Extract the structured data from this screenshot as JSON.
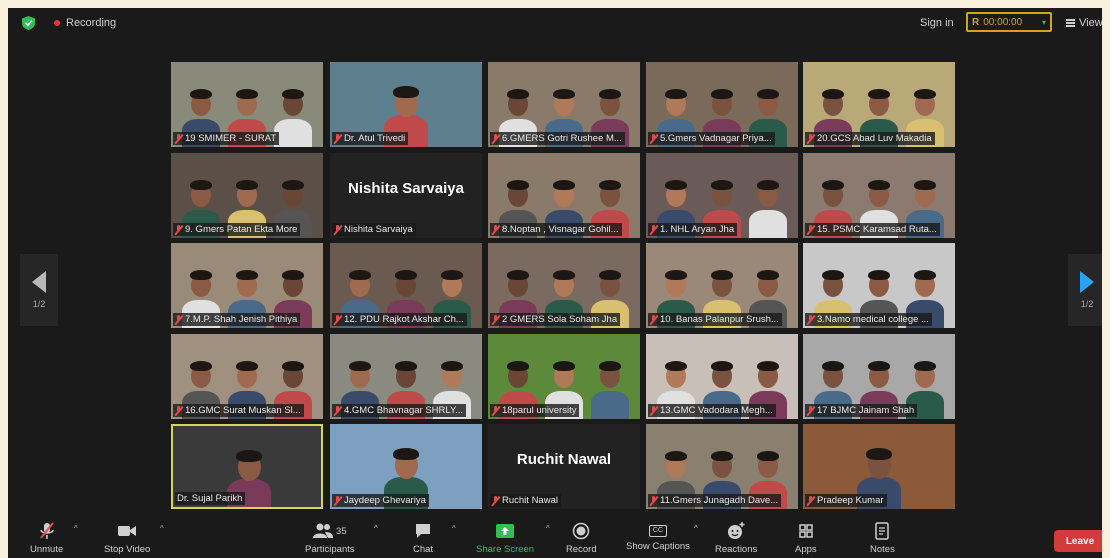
{
  "top": {
    "recording_label": "Recording",
    "sign_in": "Sign in",
    "timer": "00:00:00",
    "view_label": "View"
  },
  "pager": {
    "left": "1/2",
    "right": "1/2"
  },
  "tiles": [
    {
      "name": "19 SMIMER - SURAT",
      "people": 3,
      "bg": "#8a8a7a"
    },
    {
      "name": "Dr. Atul Trivedi",
      "people": 1,
      "bg": "#5d7f8e"
    },
    {
      "name": "6.GMERS Gotri Rushee M...",
      "people": 3,
      "bg": "#8a7a6a"
    },
    {
      "name": "5.Gmers Vadnagar Priya...",
      "people": 3,
      "bg": "#7a6a5a"
    },
    {
      "name": "20.GCS Abad Luv Makadia",
      "people": 3,
      "bg": "#b9a878"
    },
    {
      "name": "9. Gmers Patan Ekta More",
      "people": 3,
      "bg": "#5a5048"
    },
    {
      "name": "Nishita Sarvaiya",
      "people": 0,
      "bg": "#222222",
      "big": "Nishita Sarvaiya"
    },
    {
      "name": "8.Noptan , Visnagar Gohil...",
      "people": 3,
      "bg": "#8a7a6a"
    },
    {
      "name": "1. NHL Aryan Jha",
      "people": 3,
      "bg": "#6a5a58"
    },
    {
      "name": "15. PSMC Karamsad Ruta...",
      "people": 3,
      "bg": "#8a7a70"
    },
    {
      "name": "7.M.P. Shah Jenish Pithiya",
      "people": 3,
      "bg": "#9a8a78"
    },
    {
      "name": "12. PDU Rajkot Akshar Ch...",
      "people": 3,
      "bg": "#6a5a50"
    },
    {
      "name": "2 GMERS Sola Soham Jha",
      "people": 3,
      "bg": "#7a6a60"
    },
    {
      "name": "10. Banas Palanpur Srush...",
      "people": 3,
      "bg": "#9a8878"
    },
    {
      "name": "3.Namo medical college ...",
      "people": 3,
      "bg": "#c8c8c8"
    },
    {
      "name": "16.GMC Surat Muskan Sl...",
      "people": 3,
      "bg": "#a09080"
    },
    {
      "name": "4.GMC Bhavnagar SHRLY...",
      "people": 3,
      "bg": "#8a8a80"
    },
    {
      "name": "18parul university",
      "people": 3,
      "bg": "#5c8a3a"
    },
    {
      "name": "13.GMC Vadodara Megh...",
      "people": 3,
      "bg": "#c8c0b8"
    },
    {
      "name": "17 BJMC Jainam Shah",
      "people": 3,
      "bg": "#a8a8a8"
    },
    {
      "name": "Dr. Sujal Parikh",
      "people": 1,
      "bg": "#3a3a3a",
      "active": true
    },
    {
      "name": "Jaydeep Ghevariya",
      "people": 1,
      "bg": "#7da0c0"
    },
    {
      "name": "Ruchit Nawal",
      "people": 0,
      "bg": "#222222",
      "big": "Ruchit Nawal"
    },
    {
      "name": "11.Gmers Junagadh Dave...",
      "people": 3,
      "bg": "#8a8070"
    },
    {
      "name": "Pradeep Kumar",
      "people": 1,
      "bg": "#8a5a3a"
    }
  ],
  "toolbar": {
    "unmute": "Unmute",
    "stop_video": "Stop Video",
    "participants": "Participants",
    "participants_count": "35",
    "chat": "Chat",
    "share_screen": "Share Screen",
    "record": "Record",
    "show_captions": "Show Captions",
    "cc_text": "CC",
    "reactions": "Reactions",
    "apps": "Apps",
    "notes": "Notes",
    "leave": "Leave"
  },
  "colors": {
    "accent": "#d6a21e",
    "leave": "#d33a3a",
    "share": "#2fbf57",
    "active_border": "#d4d65a"
  }
}
